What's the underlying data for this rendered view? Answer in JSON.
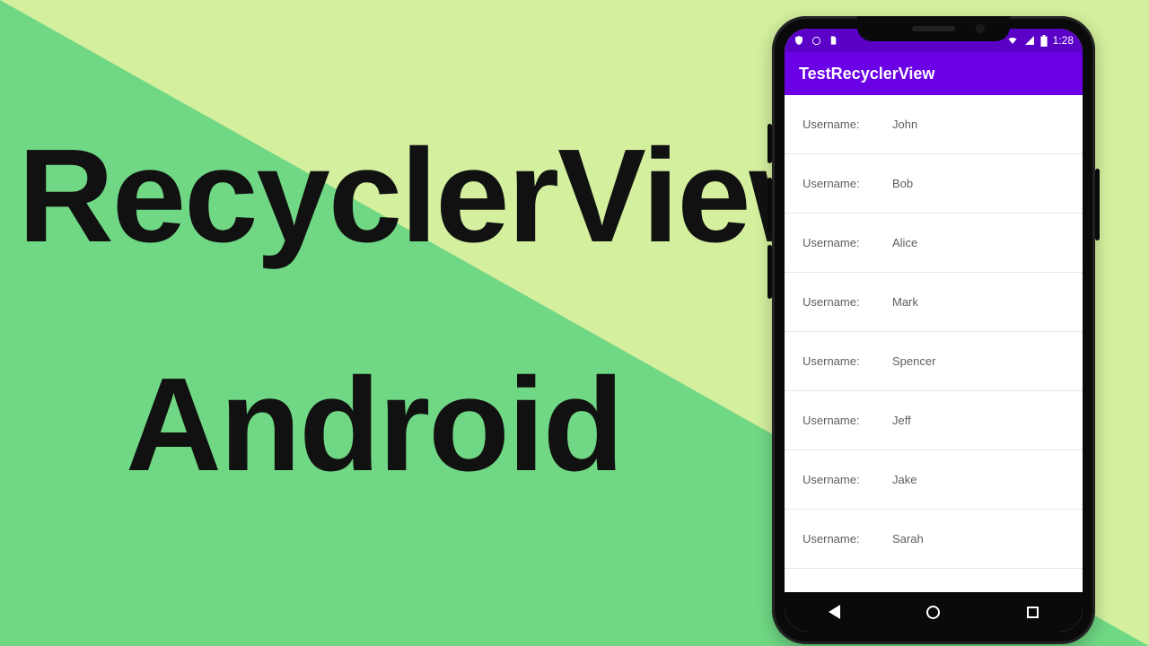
{
  "heading": {
    "line1": "RecyclerView",
    "line2": "Android"
  },
  "phone": {
    "statusbar": {
      "clock": "1:28"
    },
    "appbar": {
      "title": "TestRecyclerView"
    },
    "list": {
      "label": "Username:",
      "items": [
        {
          "name": "John"
        },
        {
          "name": "Bob"
        },
        {
          "name": "Alice"
        },
        {
          "name": "Mark"
        },
        {
          "name": "Spencer"
        },
        {
          "name": "Jeff"
        },
        {
          "name": "Jake"
        },
        {
          "name": "Sarah"
        }
      ]
    }
  }
}
